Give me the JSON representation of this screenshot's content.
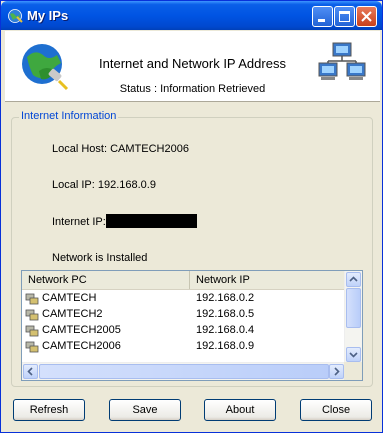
{
  "window": {
    "title": "My IPs"
  },
  "header": {
    "title": "Internet and Network IP Address",
    "status": "Status : Information Retrieved"
  },
  "group": {
    "label": "Internet Information",
    "local_host": "Local Host: CAMTECH2006",
    "local_ip": "Local IP: 192.168.0.9",
    "internet_ip_label": "Internet IP:",
    "network_status": "Network is Installed"
  },
  "list": {
    "columns": [
      "Network PC",
      "Network IP"
    ],
    "rows": [
      {
        "pc": "CAMTECH",
        "ip": "192.168.0.2"
      },
      {
        "pc": "CAMTECH2",
        "ip": "192.168.0.5"
      },
      {
        "pc": "CAMTECH2005",
        "ip": "192.168.0.4"
      },
      {
        "pc": "CAMTECH2006",
        "ip": "192.168.0.9"
      }
    ]
  },
  "buttons": {
    "refresh": "Refresh",
    "save": "Save",
    "about": "About",
    "close": "Close"
  },
  "colors": {
    "titlebar": "#0054E3",
    "group_label": "#0046D5",
    "face": "#ECE9D8"
  }
}
